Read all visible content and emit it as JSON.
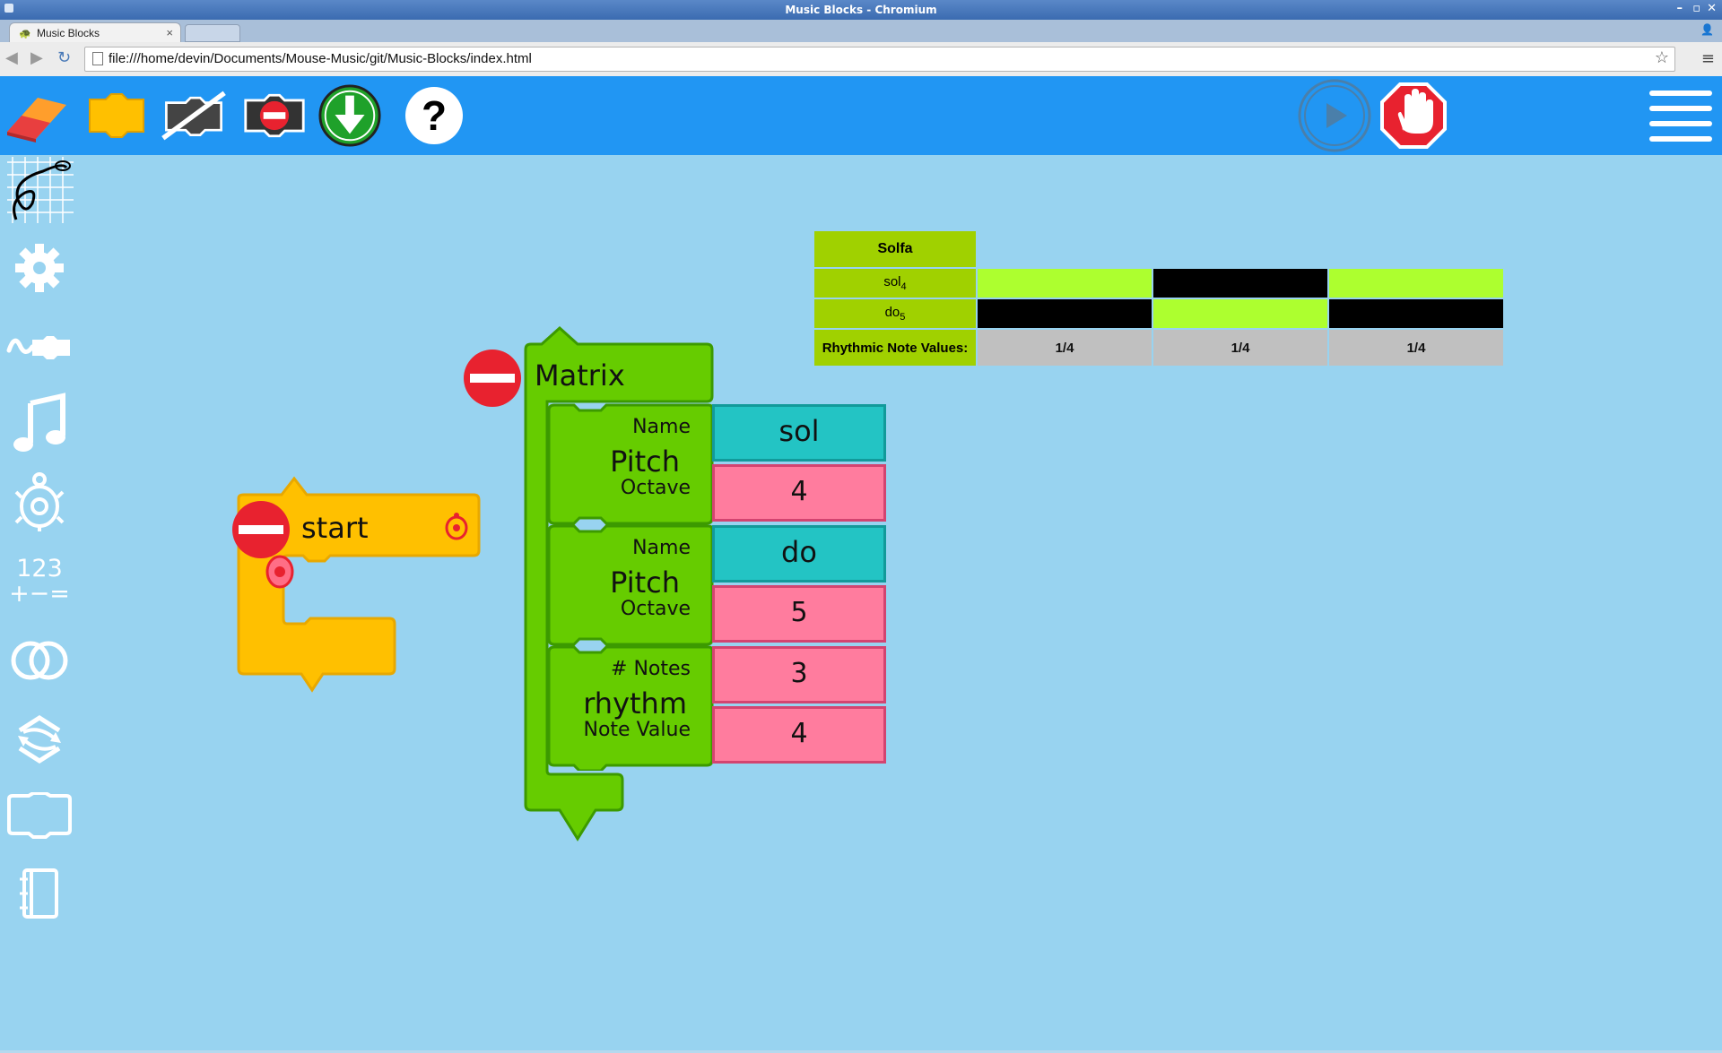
{
  "window": {
    "title": "Music Blocks - Chromium"
  },
  "tab": {
    "label": "Music Blocks",
    "close": "×"
  },
  "address_bar": {
    "url": "file:///home/devin/Documents/Mouse-Music/git/Music-Blocks/index.html"
  },
  "colors": {
    "app_bar": "#2196f3",
    "canvas": "#98d3f0",
    "matrix_label": "#a0d100",
    "matrix_on": "#adff2f",
    "matrix_off": "#000000",
    "pitch_block": "#66cc00",
    "start_block": "#ffc000",
    "name_value": "#23c4c4",
    "number_value": "#ff7c9e"
  },
  "toolbar_icons": [
    "clear-eraser-icon",
    "collapse-start-icon",
    "hide-blocks-icon",
    "delete-block-icon",
    "save-download-icon",
    "help-icon",
    "play-icon",
    "stop-hand-icon",
    "main-menu-icon"
  ],
  "palette_icons": [
    "matrix-grid-icon",
    "settings-gear-icon",
    "flow-icon",
    "music-note-icon",
    "turtle-icon",
    "number-icon",
    "boolean-rings-icon",
    "action-arrows-icon",
    "block-outline-icon",
    "journal-icon"
  ],
  "palette": {
    "number_top": "123",
    "number_bottom": "+−="
  },
  "matrix": {
    "header": "Solfa",
    "rows": [
      {
        "note": "sol",
        "octave": "4",
        "cells": [
          true,
          false,
          true
        ]
      },
      {
        "note": "do",
        "octave": "5",
        "cells": [
          false,
          true,
          false
        ]
      }
    ],
    "rhythm_label": "Rhythmic Note Values:",
    "rhythm_values": [
      "1/4",
      "1/4",
      "1/4"
    ]
  },
  "blocks": {
    "start": {
      "label": "start"
    },
    "matrix_block": {
      "label": "Matrix"
    },
    "pitch1": {
      "title": "Pitch",
      "name_label": "Name",
      "octave_label": "Octave",
      "name_value": "sol",
      "octave_value": "4"
    },
    "pitch2": {
      "title": "Pitch",
      "name_label": "Name",
      "octave_label": "Octave",
      "name_value": "do",
      "octave_value": "5"
    },
    "rhythm": {
      "title": "rhythm",
      "notes_label": "# Notes",
      "note_value_label": "Note Value",
      "notes_value": "3",
      "note_value": "4"
    }
  }
}
